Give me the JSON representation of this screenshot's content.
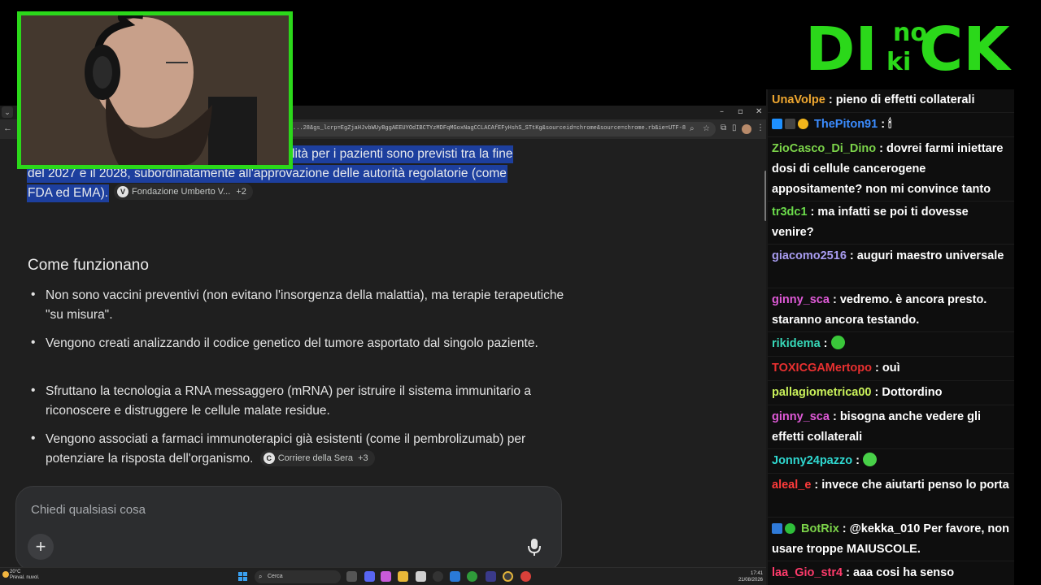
{
  "browser": {
    "url": "...28&gs_lcrp=EgZjaHJvbWUyBggAEEUYOdIBCTYzMDFqMGoxNagCCLACAfEFyHshS_STtKg&sourceid=chrome&source=chrome.rb&ie=UTF-8",
    "window_controls": [
      "–",
      "▫",
      "✕"
    ]
  },
  "article": {
    "highlight_lines": [
      "bilità per i pazienti sono previsti tra la fine",
      "del 2027 e il 2028, subordinatamente all'approvazione delle autorità regolatorie (come",
      "FDA ed EMA)."
    ],
    "source_chip_1": {
      "label": "Fondazione Umberto V...",
      "more": "+2",
      "icon": "V"
    },
    "heading": "Come funzionano",
    "bullets": [
      {
        "text": "Non sono vaccini preventivi (non evitano l'insorgenza della malattia), ma terapie terapeutiche \"su misura\"."
      },
      {
        "text": "Vengono creati analizzando il codice genetico del tumore asportato dal singolo paziente."
      },
      {
        "text": "Sfruttano la tecnologia a RNA messaggero (mRNA) per istruire il sistema immunitario a riconoscere e distruggere le cellule malate residue."
      },
      {
        "text": "Vengono associati a farmaci immunoterapici già esistenti (come il pembrolizumab) per potenziare la risposta dell'organismo."
      }
    ],
    "source_chip_2": {
      "label": "Corriere della Sera",
      "more": "+3",
      "icon": "C"
    }
  },
  "prompt": {
    "placeholder": "Chiedi qualsiasi cosa",
    "plus_label": "+"
  },
  "taskbar": {
    "temperature": "20°C",
    "weather": "Preval. nuvol.",
    "search_label": "Cerca",
    "time": "17:41",
    "date": "21/08/2026"
  },
  "logo": {
    "text_big_left": "DI",
    "text_small_top": "no",
    "text_small_bottom": "ki",
    "text_big_right": "CK",
    "color": "#2bd81a"
  },
  "chat": {
    "messages": [
      {
        "user": "UnaVolpe",
        "color": "#f0a830",
        "text": "pieno di effetti collaterali",
        "badges": []
      },
      {
        "user": "ThePiton91",
        "color": "#3b8cff",
        "text": "",
        "badges": [
          "#1e90ff",
          "#444",
          "#f3b61c"
        ],
        "emote": "🕯"
      },
      {
        "user": "ZioCasco_Di_Dino",
        "color": "#7cd44a",
        "text": "dovrei farmi iniettare dosi di cellule cancerogene appositamente? non mi convince tanto",
        "badges": []
      },
      {
        "user": "tr3dc1",
        "color": "#6bdc4b",
        "text": "ma infatti se poi ti dovesse venire?",
        "badges": []
      },
      {
        "user": "giacomo2516",
        "color": "#a89cf0",
        "text": "auguri maestro universale",
        "badges": []
      },
      {
        "user": "ginny_sca",
        "color": "#e05ad8",
        "text": "vedremo. è ancora presto. staranno ancora testando.",
        "badges": []
      },
      {
        "user": "rikidema",
        "color": "#37d8b8",
        "text": "",
        "badges": [],
        "emote_color": "#3ac73a"
      },
      {
        "user": "TOXICGAMertopo",
        "color": "#e83030",
        "text": "ouì",
        "badges": []
      },
      {
        "user": "pallagiometrica00",
        "color": "#c9f05a",
        "text": "Dottordino",
        "badges": []
      },
      {
        "user": "ginny_sca",
        "color": "#e05ad8",
        "text": "bisogna anche vedere gli effetti collaterali",
        "badges": []
      },
      {
        "user": "Jonny24pazzo",
        "color": "#2fd8d0",
        "text": "",
        "badges": [],
        "emote_color": "#48d048"
      },
      {
        "user": "aleal_e",
        "color": "#ff3b3b",
        "text": "invece che aiutarti penso lo porta",
        "badges": []
      },
      {
        "user": "BotRix",
        "color": "#7cd44a",
        "text": "@kekka_010 Per favore, non usare troppe MAIUSCOLE.",
        "badges": [
          "#2f7ad8",
          "#2fbf3a"
        ]
      },
      {
        "user": "laa_Gio_str4",
        "color": "#ff3b6b",
        "text": "aaa cosi ha senso",
        "badges": []
      }
    ]
  }
}
